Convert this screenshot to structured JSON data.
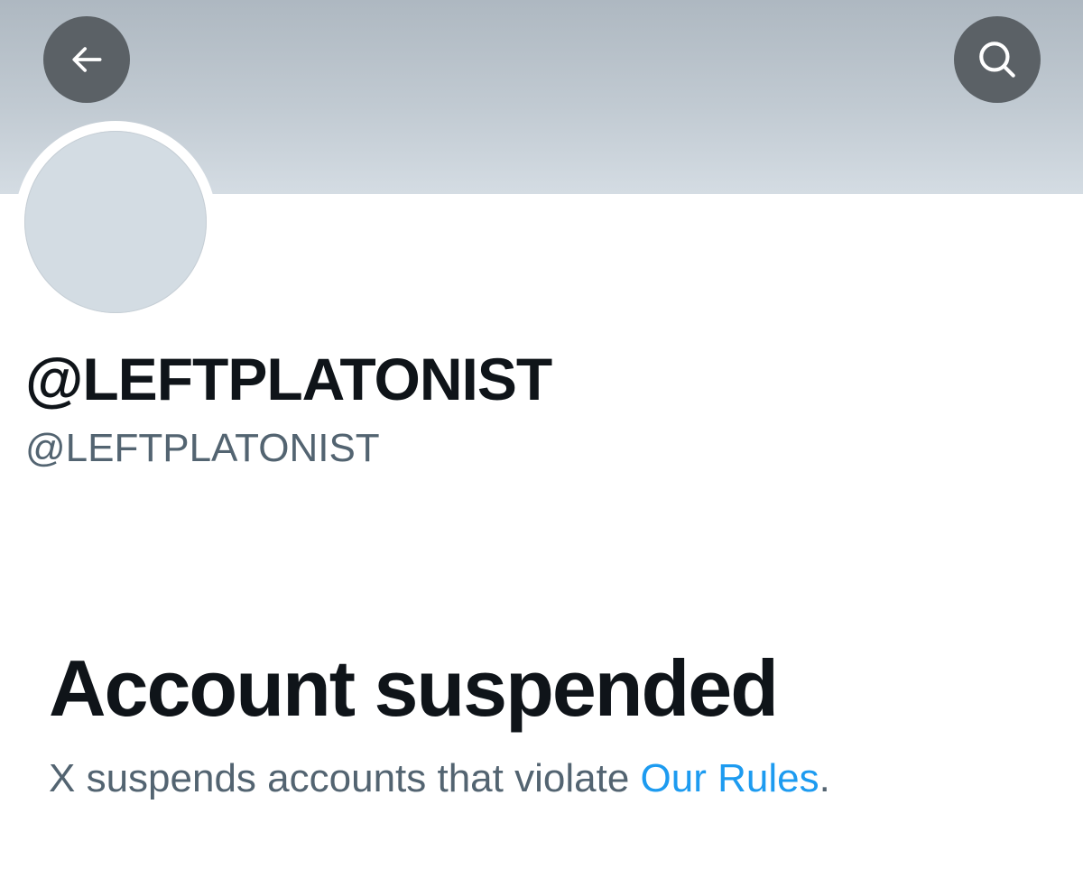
{
  "header": {
    "back_icon": "arrow-left-icon",
    "search_icon": "search-icon"
  },
  "profile": {
    "display_name": "@LEFTPLATONIST",
    "handle": "@LEFTPLATONIST"
  },
  "suspension": {
    "title": "Account suspended",
    "description_prefix": "X suspends accounts that violate ",
    "rules_link": "Our Rules",
    "description_suffix": "."
  },
  "colors": {
    "link": "#1d9bf0",
    "primary_text": "#0f1419",
    "secondary_text": "#536471",
    "button_bg": "#5b6166",
    "avatar_bg": "#d3dce3"
  }
}
